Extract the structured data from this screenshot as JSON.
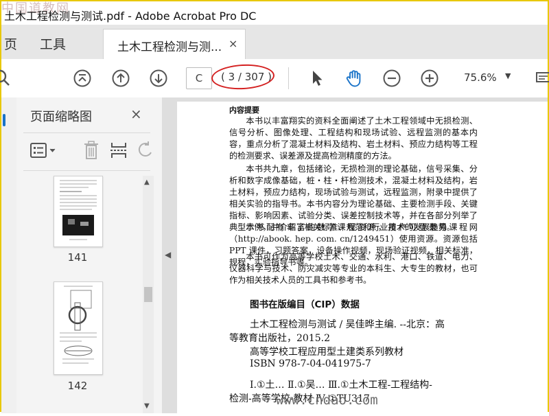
{
  "window": {
    "title": "土木工程检测与测试.pdf - Adobe Acrobat Pro DC"
  },
  "watermarks": {
    "top_left": "中国道教网",
    "bottom_right": "www.cndao.com"
  },
  "tabs": {
    "home": "页",
    "tools": "工具",
    "document": "土木工程检测与测...",
    "close": "×"
  },
  "toolbar": {
    "page_input": "C",
    "page_count": "( 3 / 307 )",
    "zoom": "75.6%",
    "zoom_dropdown": "▼",
    "icons": [
      "search-icon",
      "scroll-top-icon",
      "previous-page-icon",
      "next-page-icon",
      "select-arrow-icon",
      "hand-tool-icon",
      "zoom-out-icon",
      "zoom-in-icon",
      "more-tools-icon"
    ]
  },
  "panel": {
    "title": "页面缩略图",
    "close": "×",
    "thumbnails": [
      {
        "number": "141"
      },
      {
        "number": "142"
      }
    ]
  },
  "document": {
    "section_header": "内容提要",
    "paragraphs": [
      "本书以丰富翔实的资料全面阐述了土木工程领域中无损检测、信号分析、图像处理、工程结构和现场试验、远程监测的基本内容，重点分析了混凝土材料及结构、岩土材料、预应力结构等工程的检测要求、误差源及提高检测精度的方法。",
      "本书共九章，包括绪论，无损检测的理论基础，信号采集、分析和数字成像基础，桩・柱・杆检测技术，混凝土材料及结构，岩土材料，预应力结构，现场试验与测试，远程监测，附录中提供了相关实验的指导书。本书内容分为理论基础、主要检测手段、关键指标、影响因素、试验分类、误差控制技术等，并在各部分列举了典型示例，并介绍了相关标准、规范和行业技术的发展趋势。",
      "本书配有丰富的数字课程资源，用户可登录易课程网（http://abook. hep. com. cn/1249451）使用资源。资源包括 PPT 课件，习题答案，设备操作视频，现场验证视频，相关标准，规程，实验指导书等。",
      "本书可作为高等学校土木、交通、水利、港口、铁道、电力、仪器科学与技术、防灾减灾等专业的本科生、大专生的教材，也可作为相关技术人员的工具书和参考书。"
    ],
    "cip_title": "图书在版编目（CIP）数据",
    "cip_lines": [
      "土木工程检测与测试 / 吴佳晔主编. --北京：高",
      "等教育出版社，2015.2",
      "高等学校工程应用型土建类系列教材",
      "ISBN 978-7-04-041975-7",
      "Ⅰ.①土… Ⅱ.①吴… Ⅲ.①土木工程-工程结构-",
      "检测-高等学校-教材 Ⅳ.①TU317"
    ]
  },
  "colors": {
    "accent": "#1a73c8",
    "annotation": "#d42020",
    "frame": "#e8c800"
  }
}
